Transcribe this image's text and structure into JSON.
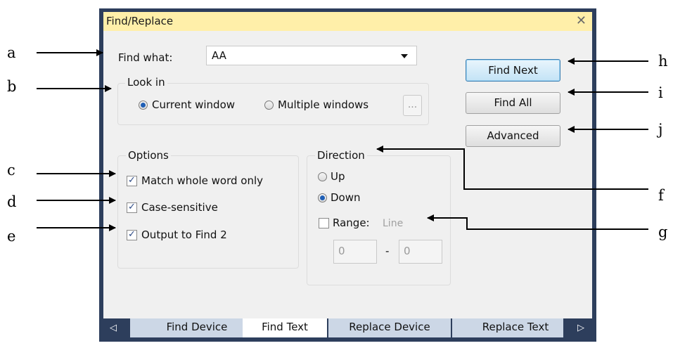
{
  "dialog": {
    "title": "Find/Replace",
    "close_glyph": "✕"
  },
  "find": {
    "label": "Find what:",
    "value": "AA"
  },
  "look_in": {
    "legend": "Look in",
    "current_window": "Current window",
    "multiple_windows": "Multiple windows",
    "browse_label": "...",
    "selected": "current_window"
  },
  "options": {
    "legend": "Options",
    "match_whole_word": {
      "label": "Match whole word only",
      "checked": true
    },
    "case_sensitive": {
      "label": "Case-sensitive",
      "checked": true
    },
    "output_find2": {
      "label": "Output to Find 2",
      "checked": true
    }
  },
  "direction": {
    "legend": "Direction",
    "up": "Up",
    "down": "Down",
    "selected": "down",
    "range_label": "Range:",
    "range_unit": "Line",
    "range_checked": false,
    "range_from": "0",
    "range_sep": "-",
    "range_to": "0"
  },
  "buttons": {
    "find_next": "Find Next",
    "find_all": "Find All",
    "advanced": "Advanced"
  },
  "tabs": [
    {
      "label": "Find Device",
      "active": false
    },
    {
      "label": "Find Text",
      "active": true
    },
    {
      "label": "Replace Device",
      "active": false
    },
    {
      "label": "Replace Text",
      "active": false
    }
  ],
  "tab_nav": {
    "left": "◁",
    "right": "▷"
  },
  "callouts": [
    "a",
    "b",
    "c",
    "d",
    "e",
    "f",
    "g",
    "h",
    "i",
    "j"
  ],
  "colors": {
    "frame": "#2d3e5c",
    "titlebar": "#ffefa9",
    "client": "#f0f0f0",
    "tab_inactive": "#ccd7e6",
    "accent_radio": "#1f5fb5"
  }
}
